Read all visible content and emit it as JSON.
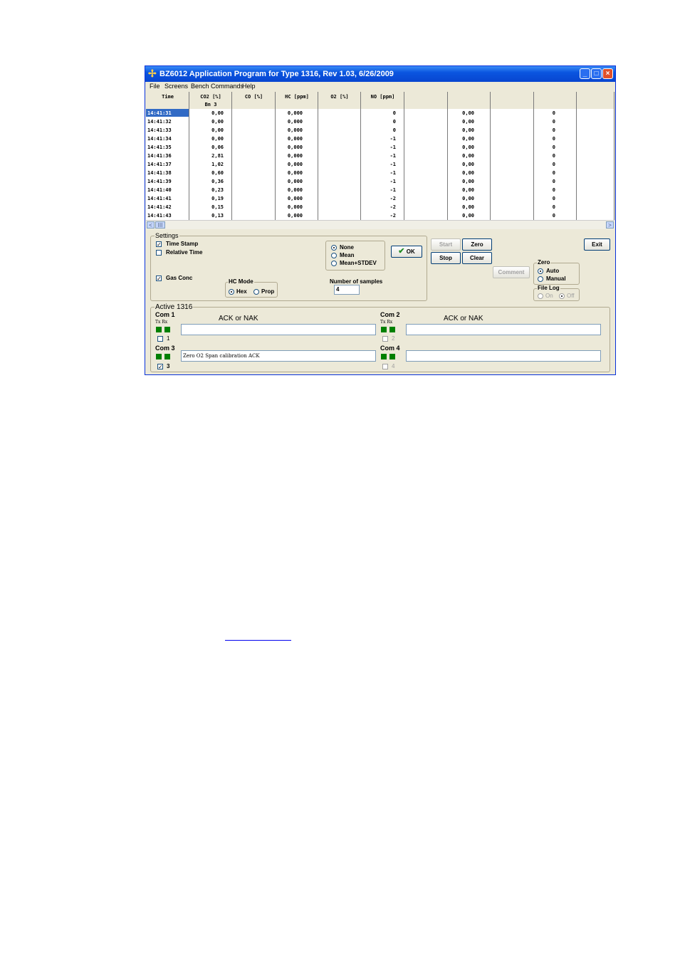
{
  "window": {
    "title": "BZ6012 Application Program for Type 1316, Rev 1.03, 6/26/2009",
    "controls": [
      "_",
      "□",
      "×"
    ]
  },
  "menu": [
    "File",
    "Screens",
    "Bench Commands",
    "Help"
  ],
  "grid": {
    "headers": [
      {
        "line1": "Time",
        "line2": ""
      },
      {
        "line1": "CO2 [%]",
        "line2": "Bn 3"
      },
      {
        "line1": "CO [%]",
        "line2": ""
      },
      {
        "line1": "HC [ppm]",
        "line2": ""
      },
      {
        "line1": "O2 [%]",
        "line2": ""
      },
      {
        "line1": "NO [ppm]",
        "line2": ""
      },
      {
        "line1": "",
        "line2": ""
      },
      {
        "line1": "",
        "line2": ""
      },
      {
        "line1": "",
        "line2": ""
      },
      {
        "line1": "",
        "line2": ""
      },
      {
        "line1": "",
        "line2": ""
      }
    ],
    "rows": [
      [
        "14:41:31",
        "0,00",
        "0,000",
        "0",
        "0,00",
        "0"
      ],
      [
        "14:41:32",
        "0,00",
        "0,000",
        "0",
        "0,00",
        "0"
      ],
      [
        "14:41:33",
        "0,00",
        "0,000",
        "0",
        "0,00",
        "0"
      ],
      [
        "14:41:34",
        "0,00",
        "0,000",
        "-1",
        "0,00",
        "0"
      ],
      [
        "14:41:35",
        "0,06",
        "0,000",
        "-1",
        "0,00",
        "0"
      ],
      [
        "14:41:36",
        "2,81",
        "0,000",
        "-1",
        "0,00",
        "0"
      ],
      [
        "14:41:37",
        "1,02",
        "0,000",
        "-1",
        "0,00",
        "0"
      ],
      [
        "14:41:38",
        "0,60",
        "0,000",
        "-1",
        "0,00",
        "0"
      ],
      [
        "14:41:39",
        "0,36",
        "0,000",
        "-1",
        "0,00",
        "0"
      ],
      [
        "14:41:40",
        "0,23",
        "0,000",
        "-1",
        "0,00",
        "0"
      ],
      [
        "14:41:41",
        "0,19",
        "0,000",
        "-2",
        "0,00",
        "0"
      ],
      [
        "14:41:42",
        "0,15",
        "0,000",
        "-2",
        "0,00",
        "0"
      ],
      [
        "14:41:43",
        "0,13",
        "0,000",
        "-2",
        "0,00",
        "0"
      ]
    ],
    "selected_row": 0,
    "scroll_left": "<",
    "scroll_right": ">",
    "scroll_thumb": "III"
  },
  "settings": {
    "legend": "Settings",
    "time_stamp": {
      "label": "Time Stamp",
      "checked": true
    },
    "relative_time": {
      "label": "Relative Time",
      "checked": false
    },
    "gas_conc": {
      "label": "Gas Conc",
      "checked": true
    },
    "hc_mode": {
      "legend": "HC Mode",
      "options": [
        "Hex",
        "Prop"
      ],
      "selected": "Hex"
    },
    "averaging": {
      "options": [
        "None",
        "Mean",
        "Mean+STDEV"
      ],
      "selected": "None"
    },
    "ok_label": "OK",
    "ok_check": "✔",
    "samples_label": "Number of samples",
    "samples_value": "4"
  },
  "buttons": {
    "start": "Start",
    "zero": "Zero",
    "stop": "Stop",
    "clear": "Clear",
    "comment": "Comment",
    "exit": "Exit"
  },
  "zero_group": {
    "legend": "Zero",
    "options": [
      "Auto",
      "Manual"
    ],
    "selected": "Auto"
  },
  "file_log": {
    "legend": "File Log",
    "options": [
      "On",
      "Off"
    ],
    "selected": "Off"
  },
  "active": {
    "legend": "Active 1316",
    "txrx": "Tx Rx",
    "coms": [
      {
        "title": "Com 1",
        "ack_label": "ACK or  NAK",
        "message": "",
        "check_label": "1",
        "checked": false,
        "enabled": true
      },
      {
        "title": "Com 2",
        "ack_label": "ACK or  NAK",
        "message": "",
        "check_label": "2",
        "checked": false,
        "enabled": false
      },
      {
        "title": "Com 3",
        "ack_label": "",
        "message": "Zero O2 Span calibration  ACK",
        "check_label": "3",
        "checked": true,
        "enabled": true
      },
      {
        "title": "Com 4",
        "ack_label": "",
        "message": "",
        "check_label": "4",
        "checked": false,
        "enabled": false
      }
    ]
  },
  "colors": {
    "title_bar": "#0a55e0",
    "window_bg": "#ece9d8",
    "led": "#008000",
    "selection": "#316ac5"
  }
}
